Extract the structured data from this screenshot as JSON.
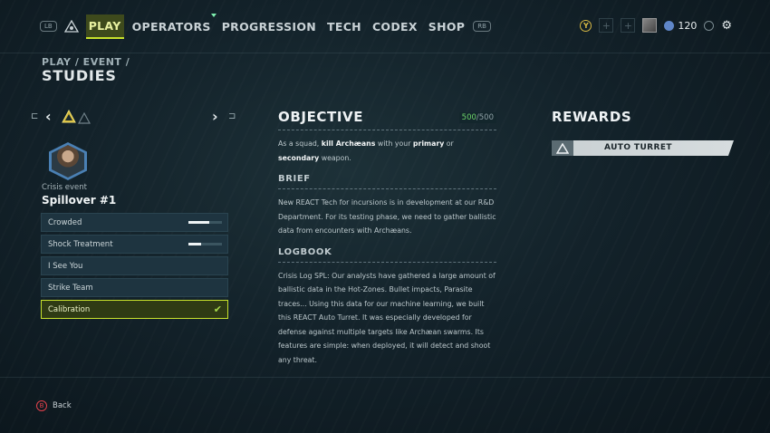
{
  "nav": {
    "lb": "LB",
    "rb": "RB",
    "tabs": [
      {
        "label": "PLAY",
        "active": true
      },
      {
        "label": "OPERATORS",
        "dot": true
      },
      {
        "label": "PROGRESSION"
      },
      {
        "label": "TECH"
      },
      {
        "label": "CODEX"
      },
      {
        "label": "SHOP"
      }
    ]
  },
  "topright": {
    "y_button": "Y",
    "plus1": "+",
    "plus2": "+",
    "currency": "120",
    "r_button": ""
  },
  "breadcrumb": "PLAY / EVENT /",
  "page_title": "STUDIES",
  "event": {
    "type_label": "Crisis event",
    "name": "Spillover #1",
    "studies": [
      {
        "label": "Crowded",
        "progress": 0.62
      },
      {
        "label": "Shock Treatment",
        "progress": 0.38
      },
      {
        "label": "I See You"
      },
      {
        "label": "Strike Team"
      },
      {
        "label": "Calibration",
        "completed": true,
        "selected": true
      }
    ]
  },
  "objective": {
    "title": "OBJECTIVE",
    "progress_current": "500",
    "progress_total": "/500",
    "text_pre": "As a squad, ",
    "text_kill": "kill Archæans",
    "text_mid": " with your ",
    "text_primary": "primary",
    "text_or": " or ",
    "text_secondary": "secondary",
    "text_post": " weapon."
  },
  "brief": {
    "title": "BRIEF",
    "text": "New REACT Tech for incursions is in development at our R&D Department. For its testing phase, we need to gather ballistic data from encounters with Archæans."
  },
  "logbook": {
    "title": "LOGBOOK",
    "text": "Crisis Log SPL: Our analysts have gathered a large amount of ballistic data in the Hot-Zones. Bullet impacts, Parasite traces... Using this data for our machine learning, we built this REACT Auto Turret. It was especially developed for defense against multiple targets like Archæan swarms. Its features are simple: when deployed, it will detect and shoot any threat."
  },
  "rewards": {
    "title": "REWARDS",
    "item": "AUTO TURRET"
  },
  "footer": {
    "back_button": "B",
    "back_label": "Back"
  },
  "colors": {
    "accent": "#c8e22c",
    "complete": "#a6d84a",
    "counter": "#6ed36a",
    "back": "#e0414b"
  }
}
